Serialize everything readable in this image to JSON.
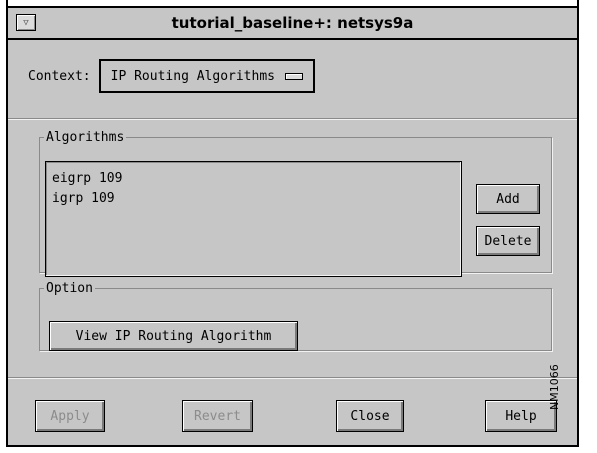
{
  "window": {
    "title": "tutorial_baseline+: netsys9a",
    "menu_glyph": "▽"
  },
  "context": {
    "label": "Context:",
    "selected": "IP Routing Algorithms"
  },
  "algorithms": {
    "legend": "Algorithms",
    "items": [
      "eigrp 109",
      "igrp 109"
    ],
    "add_label": "Add",
    "delete_label": "Delete"
  },
  "option": {
    "legend": "Option",
    "view_label": "View IP Routing Algorithm"
  },
  "footer": {
    "apply_label": "Apply",
    "revert_label": "Revert",
    "close_label": "Close",
    "help_label": "Help"
  },
  "side_note": "NM1066"
}
